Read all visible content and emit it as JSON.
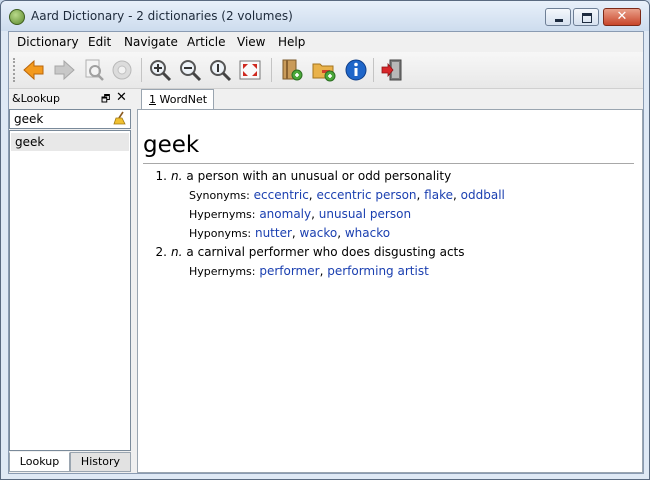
{
  "window": {
    "title": "Aard Dictionary - 2 dictionaries (2 volumes)"
  },
  "menu": [
    "Dictionary",
    "Edit",
    "Navigate",
    "Article",
    "View",
    "Help"
  ],
  "toolbar": {
    "buttons": [
      {
        "icon": "back-arrow-icon"
      },
      {
        "icon": "forward-arrow-icon"
      },
      {
        "icon": "find-in-page-icon"
      },
      {
        "icon": "lookup-disabled-icon"
      },
      {
        "icon": "zoom-in-icon"
      },
      {
        "icon": "zoom-out-icon"
      },
      {
        "icon": "zoom-reset-icon"
      },
      {
        "icon": "fullscreen-icon"
      },
      {
        "icon": "add-dictionary-icon"
      },
      {
        "icon": "add-folder-icon"
      },
      {
        "icon": "info-icon"
      },
      {
        "icon": "exit-icon"
      }
    ]
  },
  "sidepanel": {
    "title": "&Lookup",
    "search_value": "geek",
    "results": [
      "geek"
    ],
    "tabs": {
      "lookup": "Lookup",
      "history": "History"
    }
  },
  "article_tab": {
    "number": "1",
    "label": "WordNet"
  },
  "article": {
    "headword": "geek",
    "senses": [
      {
        "number": "1.",
        "pos": "n.",
        "definition": "a person with an unusual or odd personality",
        "relations": [
          {
            "label": "Synonyms:",
            "words": [
              "eccentric",
              "eccentric person",
              "flake",
              "oddball"
            ]
          },
          {
            "label": "Hypernyms:",
            "words": [
              "anomaly",
              "unusual person"
            ]
          },
          {
            "label": "Hyponyms:",
            "words": [
              "nutter",
              "wacko",
              "whacko"
            ]
          }
        ]
      },
      {
        "number": "2.",
        "pos": "n.",
        "definition": "a carnival performer who does disgusting acts",
        "relations": [
          {
            "label": "Hypernyms:",
            "words": [
              "performer",
              "performing artist"
            ]
          }
        ]
      }
    ]
  },
  "colors": {
    "link": "#1a3fb0",
    "close_button": "#c8452a"
  }
}
